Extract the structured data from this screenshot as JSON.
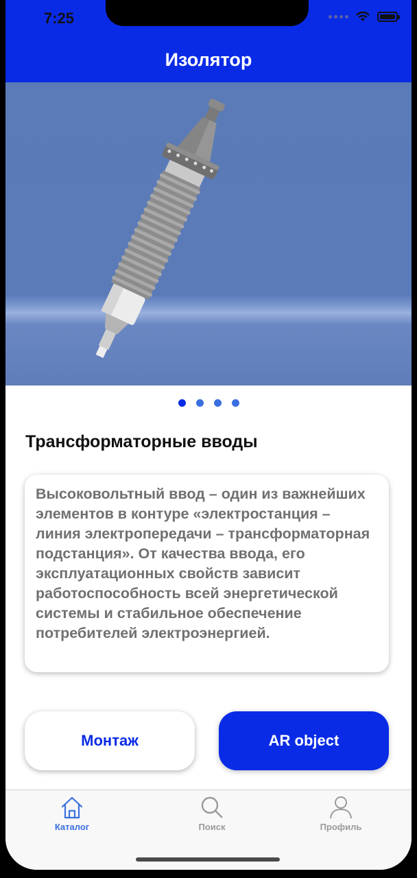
{
  "status": {
    "time": "7:25"
  },
  "nav": {
    "title": "Изолятор"
  },
  "gallery": {
    "page_count": 4,
    "active_index": 0
  },
  "section": {
    "title": "Трансформаторные вводы"
  },
  "description": {
    "text": "Высоковольтный ввод – один из важнейших элементов в контуре «электростанция – линия электропередачи – трансформаторная подстанция». От качества ввода, его эксплуатационных свойств зависит работоспособность всей энергетической системы и стабильное обеспечение потребителей электроэнергией."
  },
  "buttons": {
    "montage": "Монтаж",
    "ar": "AR object"
  },
  "tabs": {
    "catalog": "Каталог",
    "search": "Поиск",
    "profile": "Профиль"
  },
  "colors": {
    "brand": "#0a2be6",
    "active_tab": "#3a6fe0"
  }
}
